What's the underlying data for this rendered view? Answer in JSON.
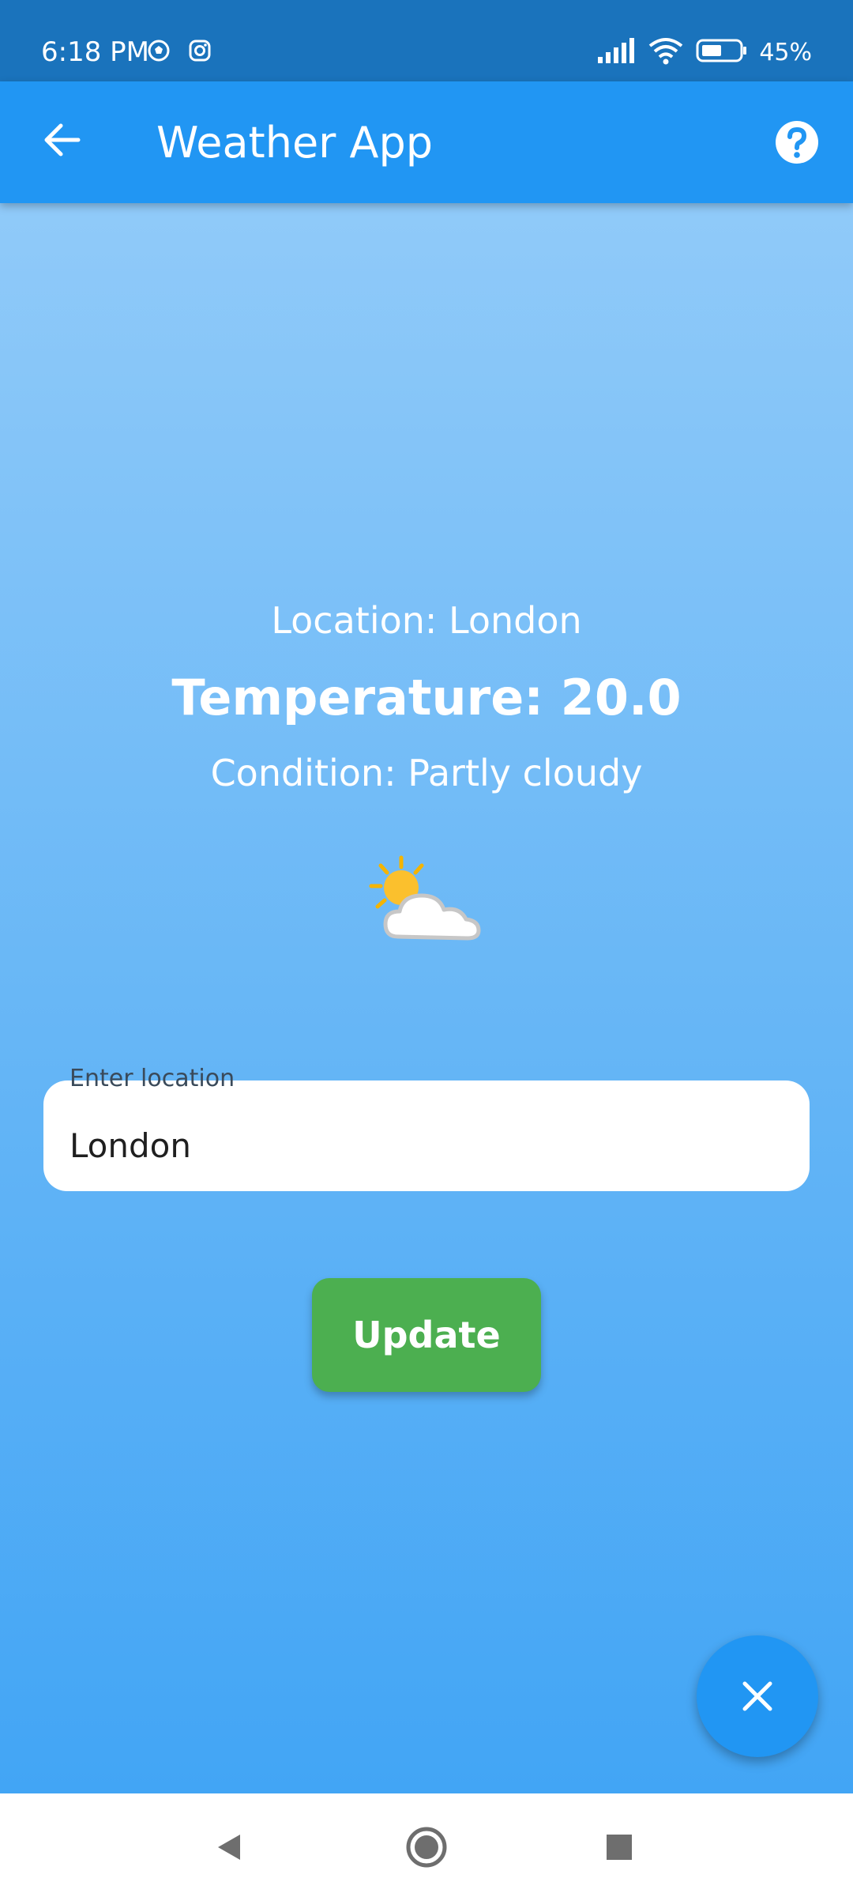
{
  "status_bar": {
    "time": "6:18 PM",
    "battery": "45%",
    "icons": [
      "soccer-ball-icon",
      "instagram-icon",
      "signal-icon",
      "wifi-icon",
      "battery-icon"
    ]
  },
  "app_bar": {
    "title": "Weather App",
    "back_icon": "arrow-back-icon",
    "help_icon": "help-circle-icon"
  },
  "weather": {
    "location_line": "Location: London",
    "temperature_line": "Temperature: 20.0",
    "condition_line": "Condition: Partly cloudy",
    "icon": "partly-cloudy-icon"
  },
  "location_input": {
    "label": "Enter location",
    "value": "London"
  },
  "update_button": {
    "label": "Update"
  },
  "fab": {
    "icon": "close-icon"
  },
  "nav_bar": {
    "icons": [
      "nav-back-icon",
      "nav-home-icon",
      "nav-recents-icon"
    ]
  },
  "colors": {
    "status_bar": "#1a73bc",
    "app_bar": "#2196f3",
    "gradient_top": "#90caf9",
    "gradient_bottom": "#42a5f5",
    "update_button": "#4caf50",
    "fab": "#2196f3"
  }
}
